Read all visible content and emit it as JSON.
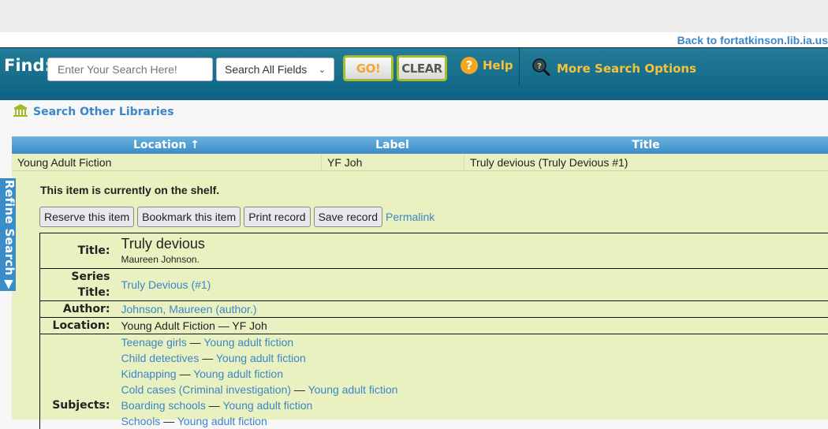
{
  "header": {
    "back_link": "Back to fortatkinson.lib.ia.us",
    "find_label": "Find:",
    "search_placeholder": "Enter Your Search Here!",
    "search_value": "",
    "search_field_selected": "Search All Fields",
    "go_label": "GO!",
    "clear_label": "CLEAR",
    "help_label": "Help",
    "more_options_label": "More Search Options",
    "colors": {
      "bar_top": "#237c98",
      "bar_bottom": "#0d6283",
      "accent_yellow": "#f5c23a",
      "button_border": "#a4be2a"
    }
  },
  "other_libraries_label": "Search Other Libraries",
  "refine_search_label": "Refine Search ▶",
  "results": {
    "columns": [
      "Location ↑",
      "Label",
      "Title"
    ],
    "rows": [
      {
        "location": "Young Adult Fiction",
        "label": "YF Joh",
        "title": "Truly devious (Truly Devious #1)"
      }
    ]
  },
  "detail": {
    "status": "This item is currently on the shelf.",
    "actions": [
      "Reserve this item",
      "Bookmark this item",
      "Print record",
      "Save record"
    ],
    "permalink": "Permalink",
    "fields": {
      "title_label": "Title:",
      "title": "Truly devious",
      "statement": "Maureen Johnson.",
      "series_label_1": "Series",
      "series_label_2": "Title:",
      "series": "Truly Devious (#1)",
      "author_label": "Author:",
      "author": "Johnson, Maureen (author.)",
      "location_label": "Location:",
      "location": "Young Adult Fiction — YF Joh",
      "subjects_label": "Subjects:",
      "subjects": [
        {
          "topic": "Teenage girls",
          "form": "Young adult fiction"
        },
        {
          "topic": "Child detectives",
          "form": "Young adult fiction"
        },
        {
          "topic": "Kidnapping",
          "form": "Young adult fiction"
        },
        {
          "topic": "Cold cases (Criminal investigation)",
          "form": "Young adult fiction"
        },
        {
          "topic": "Boarding schools",
          "form": "Young adult fiction"
        },
        {
          "topic": "Schools",
          "form": "Young adult fiction"
        }
      ],
      "separator": " — "
    }
  }
}
